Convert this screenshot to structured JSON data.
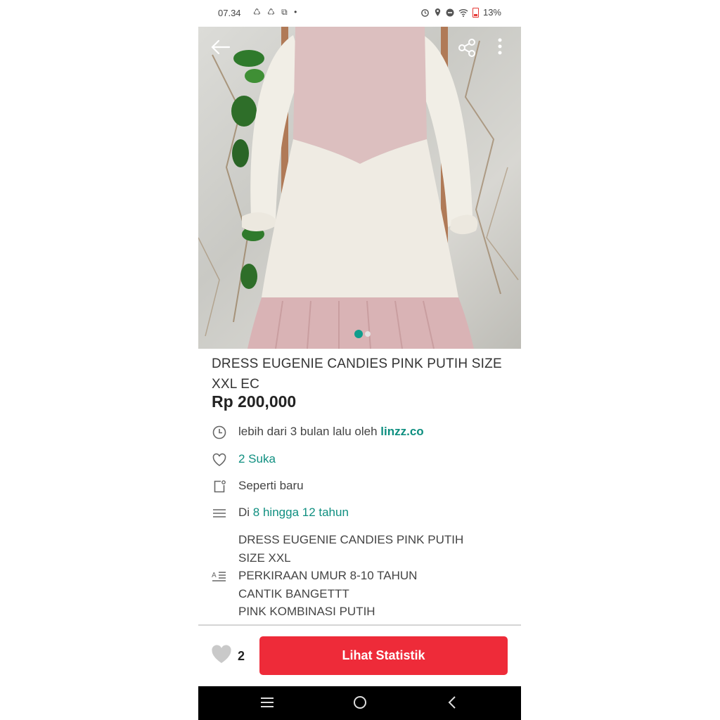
{
  "status_bar": {
    "time": "07.34",
    "left_icons": "♺ ♺ ⧉ •",
    "battery": "13%"
  },
  "header": {
    "back_icon": "arrow-left-icon",
    "share_icon": "share-icon",
    "more_icon": "more-vertical-icon"
  },
  "carousel": {
    "total": 2,
    "active": 1
  },
  "product": {
    "title": "DRESS EUGENIE CANDIES PINK PUTIH SIZE XXL EC",
    "price": "Rp 200,000"
  },
  "details": {
    "posted_prefix": "lebih dari 3 bulan lalu oleh",
    "seller": "linzz.co",
    "likes": "2 Suka",
    "condition": "Seperti baru",
    "age_prefix": "Di",
    "age_range": "8 hingga 12 tahun",
    "description": [
      "DRESS EUGENIE CANDIES PINK PUTIH",
      "SIZE XXL",
      "PERKIRAAN UMUR 8-10 TAHUN",
      "CANTIK BANGETTT",
      "PINK KOMBINASI PUTIH"
    ]
  },
  "bottom_bar": {
    "like_count": "2",
    "stats_button": "Lihat Statistik"
  },
  "colors": {
    "accent_green": "#0f8f80",
    "button_red": "#ee2b39",
    "carousel_active": "#0f9d8c"
  }
}
